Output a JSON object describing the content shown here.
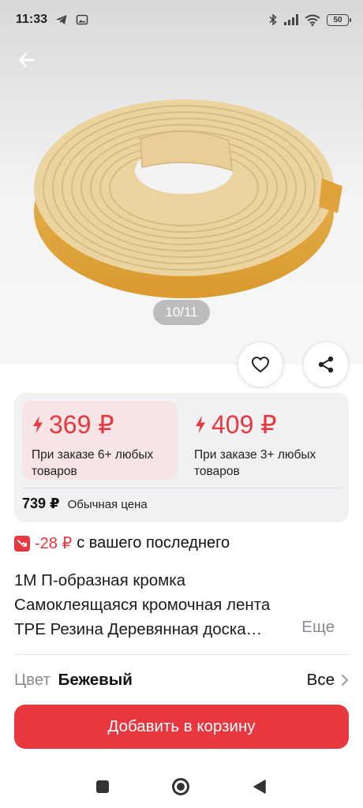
{
  "status_bar": {
    "time": "11:33",
    "battery": "50"
  },
  "gallery": {
    "counter": "10/11"
  },
  "prices": {
    "tier1": {
      "price": "369 ₽",
      "note": "При заказе 6+ любых товаров"
    },
    "tier2": {
      "price": "409 ₽",
      "note": "При заказе 3+ любых товаров"
    },
    "regular": {
      "price": "739 ₽",
      "label": "Обычная цена"
    }
  },
  "discount": {
    "value": "-28 ₽",
    "text": "с вашего последнего"
  },
  "product": {
    "title_line1": "1М П-образная кромка",
    "title_line2": "Самоклеящаяся кромочная лента",
    "title_line3": "TPE Резина Деревянная доска…",
    "more": "Еще"
  },
  "variant": {
    "label": "Цвет",
    "value": "Бежевый",
    "all": "Все"
  },
  "cart_button": "Добавить в корзину",
  "colors": {
    "accent": "#e8373f",
    "tier_highlight": "#f7e4e5",
    "card_bg": "#f1f1f4",
    "product": "#ecd4a0"
  },
  "icons": [
    "telegram-icon",
    "gallery-icon",
    "bluetooth-icon",
    "signal-icon",
    "wifi-icon",
    "back-arrow-icon",
    "heart-icon",
    "share-icon",
    "lightning-icon",
    "discount-icon",
    "chevron-right-icon"
  ]
}
